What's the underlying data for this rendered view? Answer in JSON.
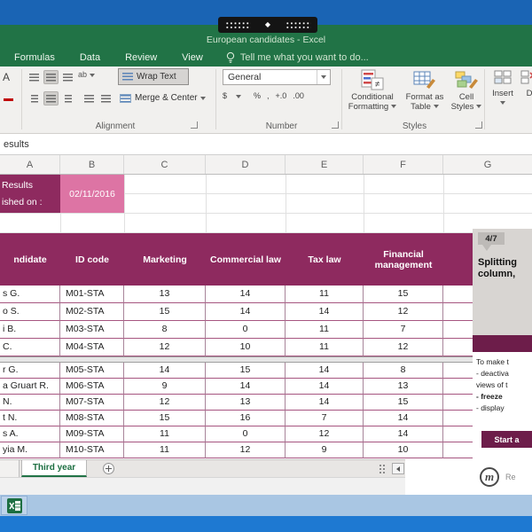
{
  "colors": {
    "excel_green": "#217346",
    "header_magenta": "#8e2a5f",
    "date_pink": "#dd74a4",
    "panel_accent": "#6d1d4a",
    "desktop_blue_top": "#1a64b4",
    "desktop_blue_bottom": "#1e79d2",
    "taskbar_blue": "#a9c6e3"
  },
  "titlebar": {
    "title": "European candidates - Excel"
  },
  "ribbon": {
    "tabs": [
      "Formulas",
      "Data",
      "Review",
      "View"
    ],
    "tell_me": "Tell me what you want to do...",
    "alignment": {
      "wrap_text": "Wrap Text",
      "merge_center": "Merge & Center",
      "label": "Alignment"
    },
    "number": {
      "format": "General",
      "label": "Number"
    },
    "styles": {
      "conditional_line1": "Conditional",
      "conditional_line2": "Formatting",
      "format_table_line1": "Format as",
      "format_table_line2": "Table",
      "cell_styles_line1": "Cell",
      "cell_styles_line2": "Styles",
      "label": "Styles"
    },
    "cells": {
      "insert": "Insert",
      "delete_partial": "D"
    },
    "icons": {
      "font_a": "A",
      "orientation": "ab",
      "dollar": "$",
      "percent": "%",
      "comma": ",",
      "inc_decimal": "+.0",
      "dec_decimal": ".00",
      "not_equal": "≠",
      "diamond": "◆"
    }
  },
  "formula_bar": {
    "text": "esults"
  },
  "columns": [
    "A",
    "B",
    "C",
    "D",
    "E",
    "F",
    "G"
  ],
  "info": {
    "line1": "Results",
    "line2": "ished on :",
    "date": "02/11/2016"
  },
  "table": {
    "headers": [
      "ndidate",
      "ID code",
      "Marketing",
      "Commercial law",
      "Tax law",
      "Financial management"
    ],
    "rows_top": [
      {
        "name": "s G.",
        "id": "M01-STA",
        "m": "13",
        "c": "14",
        "t": "11",
        "f": "15"
      },
      {
        "name": "o S.",
        "id": "M02-STA",
        "m": "15",
        "c": "14",
        "t": "14",
        "f": "12"
      },
      {
        "name": "i B.",
        "id": "M03-STA",
        "m": "8",
        "c": "0",
        "t": "11",
        "f": "7"
      },
      {
        "name": "C.",
        "id": "M04-STA",
        "m": "12",
        "c": "10",
        "t": "11",
        "f": "12"
      }
    ],
    "rows_bottom": [
      {
        "name": "r G.",
        "id": "M05-STA",
        "m": "14",
        "c": "15",
        "t": "14",
        "f": "8"
      },
      {
        "name": "a Gruart R.",
        "id": "M06-STA",
        "m": "9",
        "c": "14",
        "t": "14",
        "f": "13"
      },
      {
        "name": "N.",
        "id": "M07-STA",
        "m": "12",
        "c": "13",
        "t": "14",
        "f": "15"
      },
      {
        "name": "t N.",
        "id": "M08-STA",
        "m": "15",
        "c": "16",
        "t": "7",
        "f": "14"
      },
      {
        "name": "s A.",
        "id": "M09-STA",
        "m": "11",
        "c": "0",
        "t": "12",
        "f": "14"
      },
      {
        "name": "yia M.",
        "id": "M10-STA",
        "m": "11",
        "c": "12",
        "t": "9",
        "f": "10"
      }
    ]
  },
  "sheet_tabs": {
    "active": "Third year"
  },
  "panel": {
    "step": "4/7",
    "title_line1": "Splitting",
    "title_line2": "column,",
    "body1": "To make t",
    "body2": "- deactiva",
    "body3": "views of t",
    "body4": "- freeze",
    "body5": "- display",
    "button": "Start a",
    "footer_logo": "m",
    "footer_text": "Re"
  }
}
